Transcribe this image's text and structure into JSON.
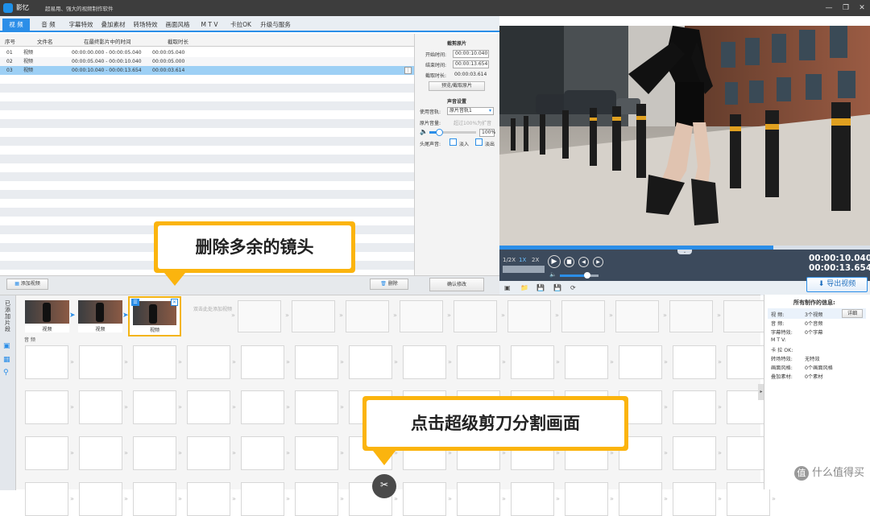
{
  "titlebar": {
    "app_name": "影忆",
    "slogan": "超易用、强大的视频制作软件"
  },
  "tabs": [
    {
      "label": "视 频"
    },
    {
      "label": "音 频"
    },
    {
      "label": "字幕特效"
    },
    {
      "label": "叠加素材"
    },
    {
      "label": "转场特效"
    },
    {
      "label": "画面风格"
    },
    {
      "label": "M T V"
    },
    {
      "label": "卡拉OK"
    },
    {
      "label": "升级与服务"
    }
  ],
  "table": {
    "headers": [
      "序号",
      "文件名",
      "在最终影片中的时间",
      "截取时长"
    ],
    "rows": [
      {
        "no": "01",
        "name": "视频",
        "time": "00:00:00.000 - 00:00:05.040",
        "dur": "00:00:05.040"
      },
      {
        "no": "02",
        "name": "视频",
        "time": "00:00:05.040 - 00:00:10.040",
        "dur": "00:00:05.000"
      },
      {
        "no": "03",
        "name": "视频",
        "time": "00:00:10.040 - 00:00:13.654",
        "dur": "00:00:03.614"
      }
    ]
  },
  "cut": {
    "title": "截剪原片",
    "start_label": "开始时间:",
    "start_value": "00:00:10.040",
    "end_label": "结束时间:",
    "end_value": "00:00:13.654",
    "dur_label": "截取时长:",
    "dur_value": "00:00:03.614",
    "preview_btn": "预览/截取原片",
    "sound_title": "声音设置",
    "track_label": "使用音轨:",
    "track_value": "原片音轨1",
    "volume_label": "原片音量:",
    "volume_hint": "超过100%为扩音",
    "volume_value": "100%",
    "volume_level": 0.2,
    "fade_label": "头尾声音:",
    "fade_in": "淡入",
    "fade_out": "淡出",
    "confirm_btn": "确认修改"
  },
  "bottom": {
    "add_video": "添加视频",
    "delete": "删除"
  },
  "player": {
    "speeds": [
      "1/2X",
      "1X",
      "2X"
    ],
    "current_time": "00:00:10.040",
    "total_time": "00:00:13.654",
    "export": "导出视频",
    "progress": 0.74,
    "volume": 0.7
  },
  "timeline": {
    "sidebar_label": "已添加片段",
    "clips": [
      {
        "label": "视频"
      },
      {
        "label": "视频"
      },
      {
        "label": "视频"
      }
    ],
    "placeholder": "双击此处添加视频",
    "audio_label": "音 频"
  },
  "info": {
    "title": "所有制作的信息:",
    "detail_btn": "详细",
    "items": [
      {
        "k": "视   频:",
        "v": "3个视频"
      },
      {
        "k": "音   频:",
        "v": "0个音频"
      },
      {
        "k": "字幕特效:",
        "v": "0个字幕"
      },
      {
        "k": "M  T  V:",
        "v": ""
      },
      {
        "k": "卡 拉 OK:",
        "v": ""
      },
      {
        "k": "转场特效:",
        "v": "无特效"
      },
      {
        "k": "画面风格:",
        "v": "0个画面风格"
      },
      {
        "k": "叠加素材:",
        "v": "0个素材"
      }
    ]
  },
  "callouts": {
    "delete_tip": "删除多余的镜头",
    "cut_tip": "点击超级剪刀分割画面"
  },
  "watermark": "什么值得买"
}
